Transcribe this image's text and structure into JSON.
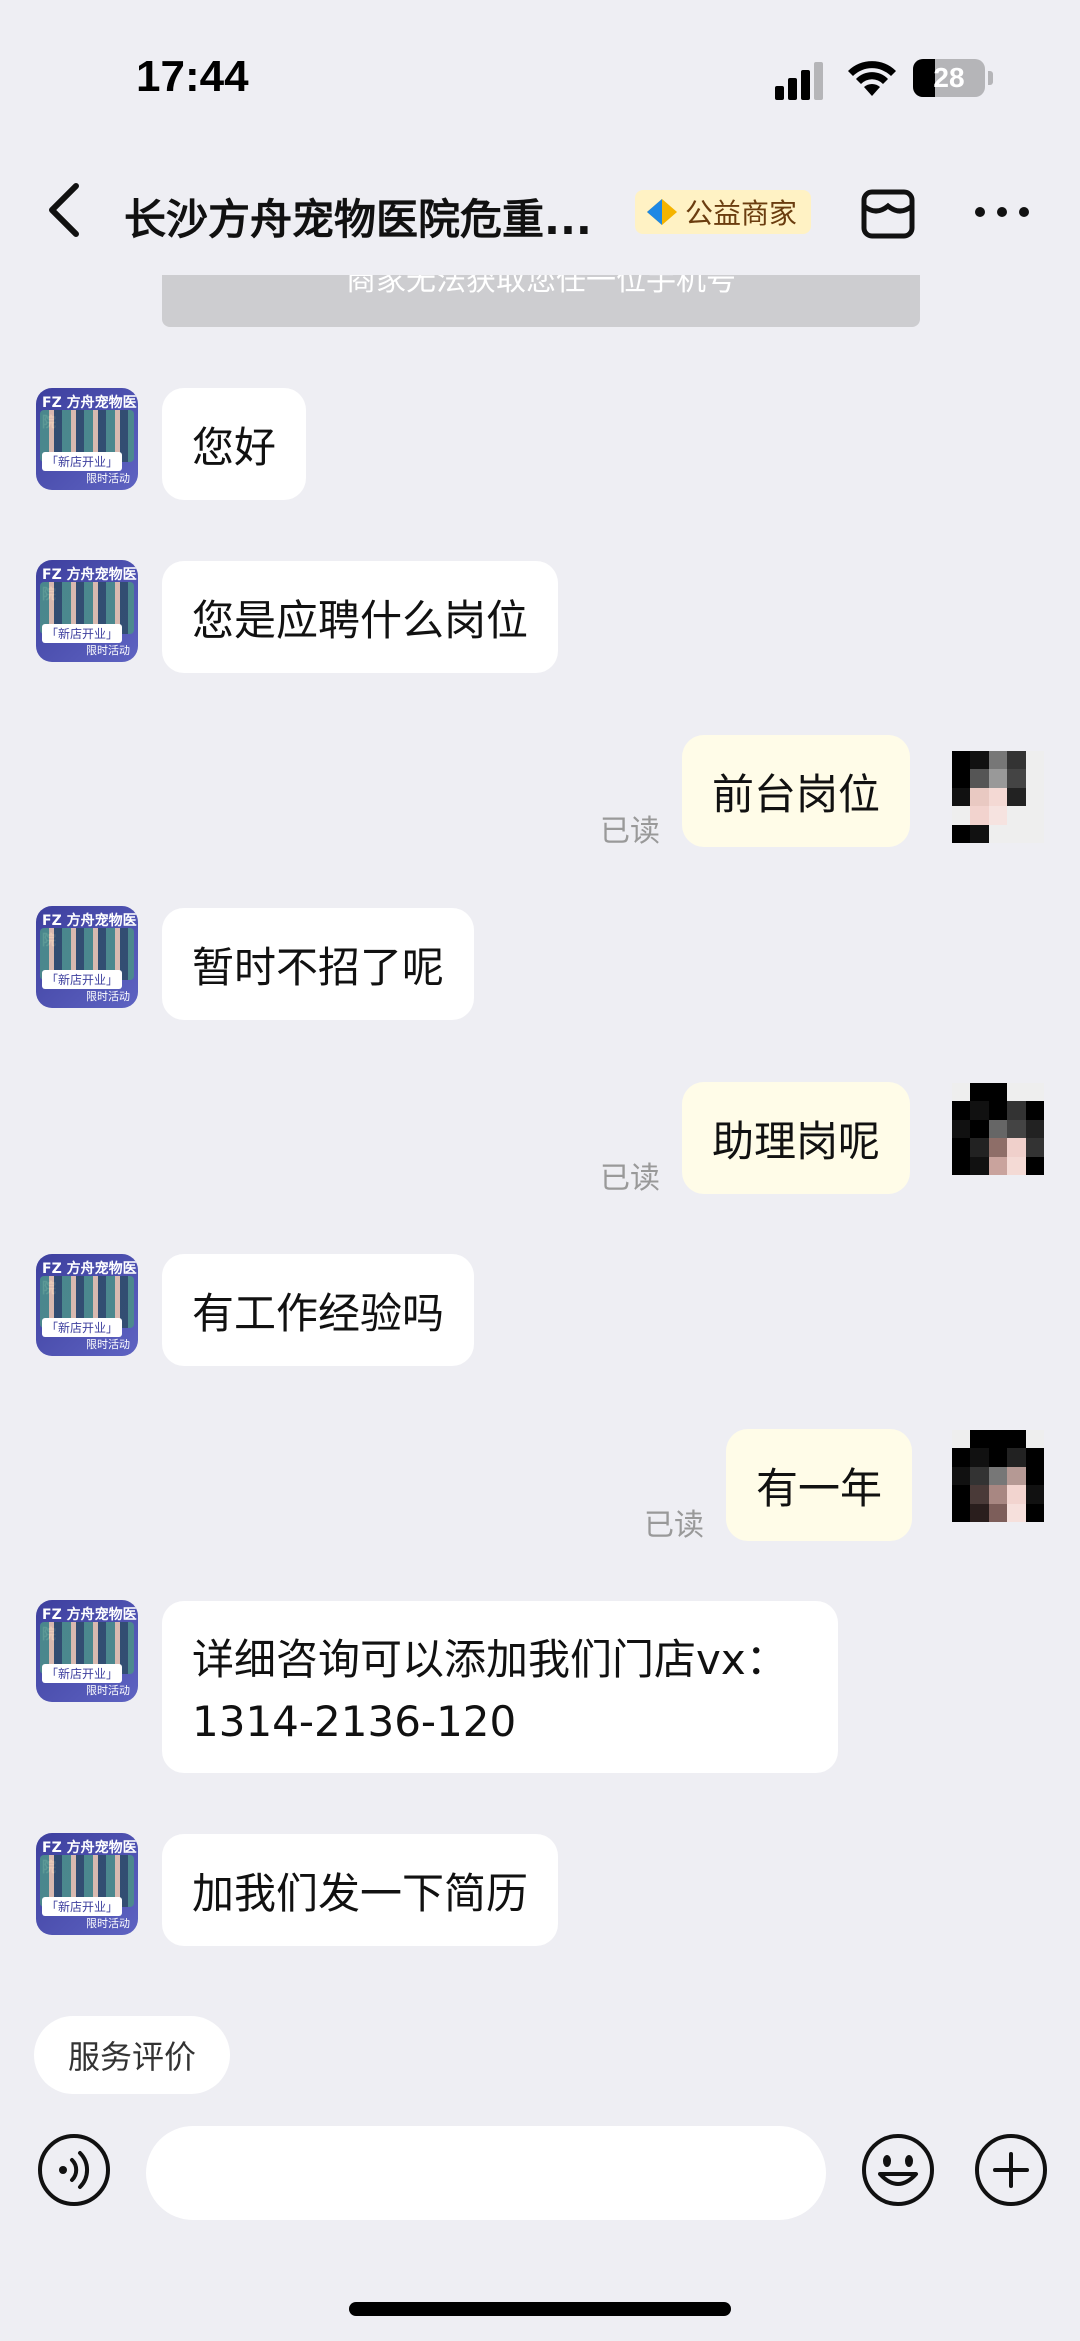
{
  "status_bar": {
    "time": "17:44",
    "battery": "28"
  },
  "header": {
    "title": "长沙方舟宠物医院危重...",
    "badge": "公益商家"
  },
  "notice": "商家无法获取您任一位手机号",
  "shop_avatar": {
    "brand": "FZ 方舟宠物医院",
    "tag1": "「新店开业」",
    "tag2": "限时活动"
  },
  "messages": [
    {
      "from": "shop",
      "text": "您好"
    },
    {
      "from": "shop",
      "text": "您是应聘什么岗位"
    },
    {
      "from": "me",
      "text": "前台岗位",
      "status": "已读"
    },
    {
      "from": "shop",
      "text": "暂时不招了呢"
    },
    {
      "from": "me",
      "text": "助理岗呢",
      "status": "已读"
    },
    {
      "from": "shop",
      "text": "有工作经验吗"
    },
    {
      "from": "me",
      "text": "有一年",
      "status": "已读"
    },
    {
      "from": "shop",
      "text_line1": "详细咨询可以添加我们门店vx：",
      "text_line2": "1314-2136-120"
    },
    {
      "from": "shop",
      "text": "加我们发一下简历"
    }
  ],
  "quick_reply": "服务评价",
  "input": {
    "placeholder": ""
  },
  "colors": {
    "background": "#EEEEF3",
    "my_bubble": "#FFFCE8",
    "shop_bubble": "#FFFFFF",
    "badge_bg": "#FFF2C4"
  }
}
